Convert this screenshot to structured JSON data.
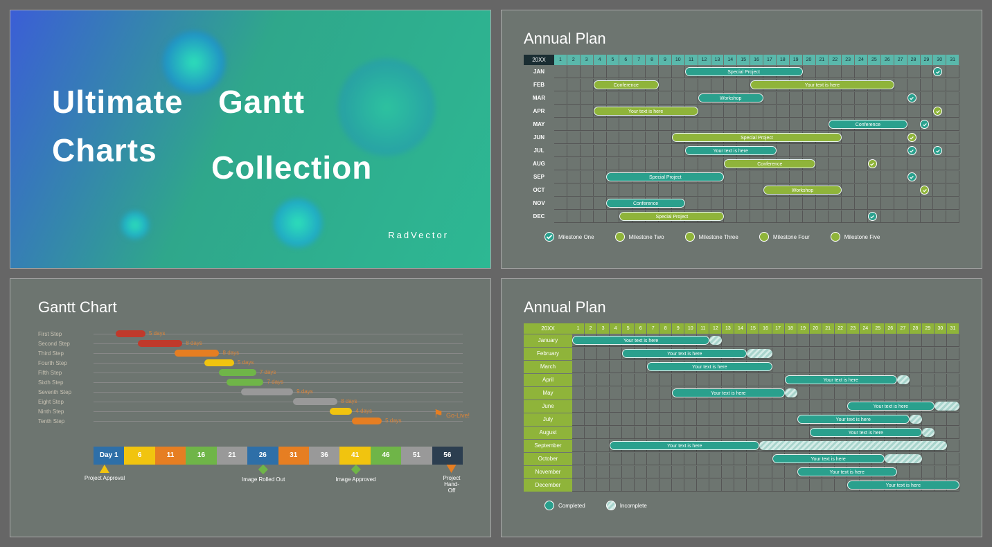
{
  "slide1": {
    "title1": "Ultimate",
    "title2": "Gantt",
    "title3": "Charts",
    "title4": "Collection",
    "brand": "RadVector"
  },
  "slide2": {
    "title": "Annual Plan",
    "year": "20XX",
    "months": [
      "JAN",
      "FEB",
      "MAR",
      "APR",
      "MAY",
      "JUN",
      "JUL",
      "AUG",
      "SEP",
      "OCT",
      "NOV",
      "DEC"
    ],
    "days": [
      "1",
      "2",
      "3",
      "4",
      "5",
      "6",
      "7",
      "8",
      "9",
      "10",
      "11",
      "12",
      "13",
      "14",
      "15",
      "16",
      "17",
      "18",
      "19",
      "20",
      "21",
      "22",
      "23",
      "24",
      "25",
      "26",
      "27",
      "28",
      "29",
      "30",
      "31"
    ],
    "bars": [
      {
        "row": 0,
        "start": 11,
        "end": 19,
        "cls": "teal",
        "label": "Special Project"
      },
      {
        "row": 1,
        "start": 4,
        "end": 8,
        "cls": "green",
        "label": "Conference"
      },
      {
        "row": 1,
        "start": 16,
        "end": 26,
        "cls": "green",
        "label": "Your text is here"
      },
      {
        "row": 2,
        "start": 12,
        "end": 16,
        "cls": "teal",
        "label": "Workshop"
      },
      {
        "row": 3,
        "start": 4,
        "end": 11,
        "cls": "green",
        "label": "Your text is here"
      },
      {
        "row": 4,
        "start": 22,
        "end": 27,
        "cls": "teal",
        "label": "Conference"
      },
      {
        "row": 5,
        "start": 10,
        "end": 22,
        "cls": "green",
        "label": "Special Project"
      },
      {
        "row": 6,
        "start": 11,
        "end": 17,
        "cls": "teal",
        "label": "Your text is here"
      },
      {
        "row": 7,
        "start": 14,
        "end": 20,
        "cls": "green",
        "label": "Conference"
      },
      {
        "row": 8,
        "start": 5,
        "end": 13,
        "cls": "teal",
        "label": "Special Project"
      },
      {
        "row": 9,
        "start": 17,
        "end": 22,
        "cls": "green",
        "label": "Workshop"
      },
      {
        "row": 10,
        "start": 5,
        "end": 10,
        "cls": "teal",
        "label": "Conference"
      },
      {
        "row": 11,
        "start": 6,
        "end": 13,
        "cls": "green",
        "label": "Special Project"
      }
    ],
    "milestones": [
      {
        "row": 0,
        "day": 30,
        "cls": "teal"
      },
      {
        "row": 2,
        "day": 28,
        "cls": "teal"
      },
      {
        "row": 3,
        "day": 30,
        "cls": "green"
      },
      {
        "row": 4,
        "day": 29,
        "cls": "teal"
      },
      {
        "row": 5,
        "day": 28,
        "cls": "green"
      },
      {
        "row": 6,
        "day": 28,
        "cls": "teal"
      },
      {
        "row": 6,
        "day": 30,
        "cls": "teal"
      },
      {
        "row": 7,
        "day": 25,
        "cls": "green"
      },
      {
        "row": 8,
        "day": 28,
        "cls": "teal"
      },
      {
        "row": 9,
        "day": 29,
        "cls": "green"
      },
      {
        "row": 11,
        "day": 25,
        "cls": "teal"
      }
    ],
    "legend": [
      "Milestone One",
      "Milestone Two",
      "Milestone Three",
      "Milestone Four",
      "Milestone Five"
    ]
  },
  "slide3": {
    "title": "Gantt Chart",
    "steps": [
      {
        "label": "First Step",
        "start": 6,
        "len": 8,
        "cls": "c-red",
        "dur": "5 days"
      },
      {
        "label": "Second Step",
        "start": 12,
        "len": 12,
        "cls": "c-red",
        "dur": "8 days"
      },
      {
        "label": "Third Step",
        "start": 22,
        "len": 12,
        "cls": "c-orange",
        "dur": "8 days"
      },
      {
        "label": "Fourth Step",
        "start": 30,
        "len": 8,
        "cls": "c-yellow",
        "dur": "5 days"
      },
      {
        "label": "Fifth Step",
        "start": 34,
        "len": 10,
        "cls": "c-green",
        "dur": "7 days"
      },
      {
        "label": "Sixth Step",
        "start": 36,
        "len": 10,
        "cls": "c-green",
        "dur": "7 days"
      },
      {
        "label": "Seventh Step",
        "start": 40,
        "len": 14,
        "cls": "c-grey",
        "dur": "9 days"
      },
      {
        "label": "Eight Step",
        "start": 54,
        "len": 12,
        "cls": "c-grey",
        "dur": "8 days"
      },
      {
        "label": "Ninth Step",
        "start": 64,
        "len": 6,
        "cls": "c-yellow",
        "dur": "4 days"
      },
      {
        "label": "Tenth Step",
        "start": 70,
        "len": 8,
        "cls": "c-orange",
        "dur": "5 days"
      }
    ],
    "timeline": [
      "Day 1",
      "6",
      "11",
      "16",
      "21",
      "26",
      "31",
      "36",
      "41",
      "46",
      "51",
      "56"
    ],
    "tlColors": [
      "c-blue",
      "c-yellow",
      "c-orange",
      "c-green",
      "c-grey",
      "c-blue",
      "c-orange",
      "c-grey",
      "c-yellow",
      "c-green",
      "c-grey",
      "c-navy"
    ],
    "milestones": [
      {
        "pos": 3,
        "type": "arrow",
        "label": "Project Approval"
      },
      {
        "pos": 46,
        "type": "diamond",
        "label": "Image Rolled Out"
      },
      {
        "pos": 71,
        "type": "diamond",
        "label": "Image Approved"
      },
      {
        "pos": 97,
        "type": "arrowDown",
        "label": "Project Hand-Off"
      }
    ],
    "golive": "Go-Live!"
  },
  "slide4": {
    "title": "Annual Plan",
    "year": "20XX",
    "months": [
      "January",
      "February",
      "March",
      "April",
      "May",
      "June",
      "July",
      "August",
      "September",
      "October",
      "November",
      "December"
    ],
    "days": [
      "1",
      "2",
      "3",
      "4",
      "5",
      "6",
      "7",
      "8",
      "9",
      "10",
      "11",
      "12",
      "13",
      "14",
      "15",
      "16",
      "17",
      "18",
      "19",
      "20",
      "21",
      "22",
      "23",
      "24",
      "25",
      "26",
      "27",
      "28",
      "29",
      "30",
      "31"
    ],
    "bars": [
      {
        "row": 0,
        "start": 1,
        "end": 11,
        "cls": "teal",
        "label": "Your text is here",
        "tail": 1
      },
      {
        "row": 1,
        "start": 5,
        "end": 14,
        "cls": "teal",
        "label": "Your text is here",
        "tail": 2
      },
      {
        "row": 2,
        "start": 7,
        "end": 16,
        "cls": "teal",
        "label": "Your text is here",
        "tail": 0
      },
      {
        "row": 3,
        "start": 18,
        "end": 26,
        "cls": "teal",
        "label": "Your text is here",
        "tail": 1
      },
      {
        "row": 4,
        "start": 9,
        "end": 17,
        "cls": "teal",
        "label": "Your text is here",
        "tail": 1
      },
      {
        "row": 5,
        "start": 23,
        "end": 29,
        "cls": "teal",
        "label": "Your text is here",
        "tail": 2
      },
      {
        "row": 6,
        "start": 19,
        "end": 27,
        "cls": "teal",
        "label": "Your text is here",
        "tail": 1
      },
      {
        "row": 7,
        "start": 20,
        "end": 28,
        "cls": "teal",
        "label": "Your text is here",
        "tail": 1
      },
      {
        "row": 8,
        "start": 4,
        "end": 15,
        "cls": "teal",
        "label": "Your text is here",
        "tail": 15
      },
      {
        "row": 9,
        "start": 17,
        "end": 25,
        "cls": "teal",
        "label": "Your text is here",
        "tail": 3
      },
      {
        "row": 10,
        "start": 19,
        "end": 26,
        "cls": "teal",
        "label": "Your text is here",
        "tail": 0
      },
      {
        "row": 11,
        "start": 23,
        "end": 31,
        "cls": "teal",
        "label": "Your text is here",
        "tail": 0
      }
    ],
    "legend": [
      {
        "label": "Completed",
        "cls": "teal"
      },
      {
        "label": "Incomplete",
        "cls": "hatch"
      }
    ]
  },
  "chart_data": [
    {
      "type": "gantt",
      "title": "Annual Plan",
      "x_axis": "day 1-31",
      "y_axis": "months JAN-DEC",
      "series": [
        {
          "row": "JAN",
          "start": 11,
          "end": 19,
          "label": "Special Project",
          "color": "teal"
        },
        {
          "row": "FEB",
          "start": 4,
          "end": 8,
          "label": "Conference",
          "color": "green"
        },
        {
          "row": "FEB",
          "start": 16,
          "end": 26,
          "label": "Your text is here",
          "color": "green"
        },
        {
          "row": "MAR",
          "start": 12,
          "end": 16,
          "label": "Workshop",
          "color": "teal"
        },
        {
          "row": "APR",
          "start": 4,
          "end": 11,
          "label": "Your text is here",
          "color": "green"
        },
        {
          "row": "MAY",
          "start": 22,
          "end": 27,
          "label": "Conference",
          "color": "teal"
        },
        {
          "row": "JUN",
          "start": 10,
          "end": 22,
          "label": "Special Project",
          "color": "green"
        },
        {
          "row": "JUL",
          "start": 11,
          "end": 17,
          "label": "Your text is here",
          "color": "teal"
        },
        {
          "row": "AUG",
          "start": 14,
          "end": 20,
          "label": "Conference",
          "color": "green"
        },
        {
          "row": "SEP",
          "start": 5,
          "end": 13,
          "label": "Special Project",
          "color": "teal"
        },
        {
          "row": "OCT",
          "start": 17,
          "end": 22,
          "label": "Workshop",
          "color": "green"
        },
        {
          "row": "NOV",
          "start": 5,
          "end": 10,
          "label": "Conference",
          "color": "teal"
        },
        {
          "row": "DEC",
          "start": 6,
          "end": 13,
          "label": "Special Project",
          "color": "green"
        }
      ],
      "milestones_legend": [
        "Milestone One",
        "Milestone Two",
        "Milestone Three",
        "Milestone Four",
        "Milestone Five"
      ]
    },
    {
      "type": "gantt",
      "title": "Gantt Chart",
      "x_axis": "Day 1-56",
      "y_axis": "steps",
      "series": [
        {
          "name": "First Step",
          "duration_days": 5,
          "start_day": 1,
          "color": "red"
        },
        {
          "name": "Second Step",
          "duration_days": 8,
          "start_day": 5,
          "color": "red"
        },
        {
          "name": "Third Step",
          "duration_days": 8,
          "start_day": 12,
          "color": "orange"
        },
        {
          "name": "Fourth Step",
          "duration_days": 5,
          "start_day": 18,
          "color": "yellow"
        },
        {
          "name": "Fifth Step",
          "duration_days": 7,
          "start_day": 21,
          "color": "green"
        },
        {
          "name": "Sixth Step",
          "duration_days": 7,
          "start_day": 22,
          "color": "green"
        },
        {
          "name": "Seventh Step",
          "duration_days": 9,
          "start_day": 25,
          "color": "grey"
        },
        {
          "name": "Eight Step",
          "duration_days": 8,
          "start_day": 33,
          "color": "grey"
        },
        {
          "name": "Ninth Step",
          "duration_days": 4,
          "start_day": 39,
          "color": "yellow"
        },
        {
          "name": "Tenth Step",
          "duration_days": 5,
          "start_day": 43,
          "color": "orange"
        }
      ],
      "milestones": [
        {
          "day": 1,
          "label": "Project Approval"
        },
        {
          "day": 26,
          "label": "Image Rolled Out"
        },
        {
          "day": 41,
          "label": "Image Approved"
        },
        {
          "day": 56,
          "label": "Project Hand-Off"
        },
        {
          "day": 56,
          "label": "Go-Live!"
        }
      ]
    },
    {
      "type": "gantt",
      "title": "Annual Plan",
      "x_axis": "day 1-31",
      "y_axis": "months January-December",
      "series": [
        {
          "row": "January",
          "start": 1,
          "end": 11,
          "label": "Your text is here"
        },
        {
          "row": "February",
          "start": 5,
          "end": 14,
          "label": "Your text is here"
        },
        {
          "row": "March",
          "start": 7,
          "end": 16,
          "label": "Your text is here"
        },
        {
          "row": "April",
          "start": 18,
          "end": 26,
          "label": "Your text is here"
        },
        {
          "row": "May",
          "start": 9,
          "end": 17,
          "label": "Your text is here"
        },
        {
          "row": "June",
          "start": 23,
          "end": 29,
          "label": "Your text is here"
        },
        {
          "row": "July",
          "start": 19,
          "end": 27,
          "label": "Your text is here"
        },
        {
          "row": "August",
          "start": 20,
          "end": 28,
          "label": "Your text is here"
        },
        {
          "row": "September",
          "start": 4,
          "end": 15,
          "label": "Your text is here"
        },
        {
          "row": "October",
          "start": 17,
          "end": 25,
          "label": "Your text is here"
        },
        {
          "row": "November",
          "start": 19,
          "end": 26,
          "label": "Your text is here"
        },
        {
          "row": "December",
          "start": 23,
          "end": 31,
          "label": "Your text is here"
        }
      ],
      "legend": [
        "Completed",
        "Incomplete"
      ]
    }
  ]
}
